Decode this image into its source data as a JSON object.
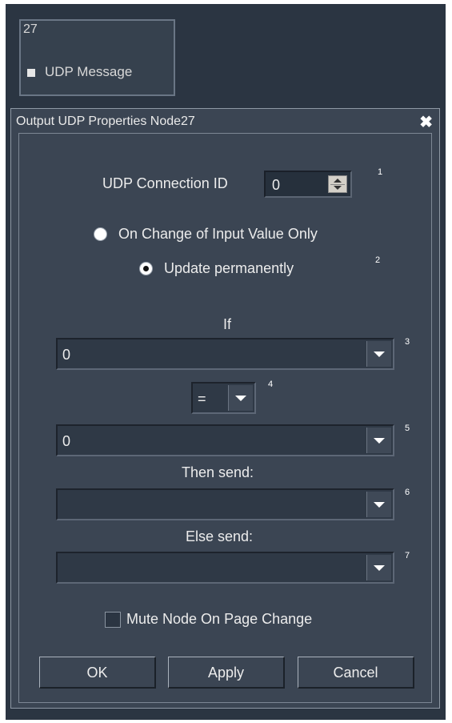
{
  "node": {
    "number": "27",
    "title": "UDP Message"
  },
  "dialog": {
    "title": "Output UDP Properties Node27",
    "close_glyph": "✖",
    "connection": {
      "label": "UDP Connection ID",
      "value": "0",
      "marker": "1"
    },
    "radio": {
      "option1": "On Change of Input Value Only",
      "option2": "Update permanently",
      "marker": "2",
      "selected": "option2"
    },
    "if": {
      "label": "If",
      "value": "0",
      "marker": "3"
    },
    "operator": {
      "value": "=",
      "marker": "4"
    },
    "compare": {
      "value": "0",
      "marker": "5"
    },
    "then_send": {
      "label": "Then send:",
      "value": "",
      "marker": "6"
    },
    "else_send": {
      "label": "Else send:",
      "value": "",
      "marker": "7"
    },
    "mute": {
      "label": "Mute Node On Page Change",
      "checked": false
    },
    "buttons": {
      "ok": "OK",
      "apply": "Apply",
      "cancel": "Cancel"
    }
  },
  "colors": {
    "background": "#2b3542",
    "dialog": "#3b4553",
    "field": "#2f3946",
    "text": "#ececec"
  }
}
